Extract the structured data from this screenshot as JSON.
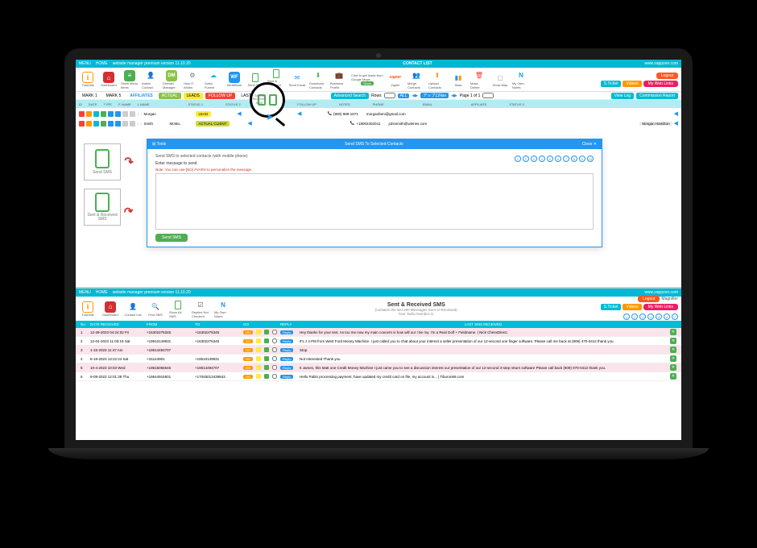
{
  "upper": {
    "header": {
      "menu": "MENU",
      "home": "HOME",
      "status_text": "website manager premium version 11.10.20",
      "title": "CONTACT LIST",
      "site": "www.zappzen.com"
    },
    "toolbar": {
      "items": [
        {
          "label": "Tutorials",
          "icon": "info"
        },
        {
          "label": "Dashboard",
          "icon": "home"
        },
        {
          "label": "Show Menu Items",
          "icon": "green"
        },
        {
          "label": "Admin Contact",
          "icon": "user"
        },
        {
          "label": "Domain Manager",
          "icon": "dm"
        },
        {
          "label": "How IT Works",
          "icon": "gear"
        },
        {
          "label": "Sales Funnel",
          "icon": "cloud"
        },
        {
          "label": "Workflows",
          "icon": "wf"
        },
        {
          "label": "Send SMS",
          "icon": "phone-green"
        },
        {
          "label": "Sent & Received SMS",
          "icon": "phone-green"
        },
        {
          "label": "Send Email",
          "icon": "mail"
        },
        {
          "label": "Download Contacts",
          "icon": "download"
        },
        {
          "label": "Business Profile",
          "icon": "briefcase"
        },
        {
          "label": "Google Maps",
          "icon": "gmaps",
          "extra": "Click to get leads from Google Maps"
        },
        {
          "label": "Zapier",
          "icon": "zapier"
        },
        {
          "label": "Merge Contacts",
          "icon": "merge"
        },
        {
          "label": "Upload Contacts",
          "icon": "upload"
        },
        {
          "label": "Stats",
          "icon": "bars"
        },
        {
          "label": "Mass Delete",
          "icon": "trash"
        },
        {
          "label": "Show Map",
          "icon": "map"
        },
        {
          "label": "My Own Notes",
          "icon": "n"
        }
      ],
      "right": {
        "logout": "Logout",
        "ticket": "S.Ticket",
        "videos": "Videos",
        "weblinks": "My Web Links"
      }
    },
    "tabs": {
      "mark1": "MARK 1",
      "mark5": "MARK 5",
      "affiliates": "AFFILIATES",
      "actual": "ACTUAL",
      "leads": "LEADS",
      "followup": "FOLLOW UP",
      "last20": "LAST 20",
      "sms": "SMS",
      "advanced_search": "Advanced Search",
      "rows": "Rows",
      "page_total": "Page 1 of 1",
      "btn_all": "ALL",
      "viewlog": "View Log",
      "commission": "Commission Report"
    },
    "filter_cols": [
      "ID",
      "DATE",
      "TYPE",
      "F. NAME",
      "L.NAME",
      "STATUS 1",
      "STATUS 2",
      "GROUP",
      "FOLLOW UP",
      "NOTES",
      "PHONE",
      "EMAIL",
      "AFFILIATE",
      "STATUS 3"
    ],
    "contacts": [
      {
        "fname": "Morgan",
        "lname": "",
        "status1": "LEAD",
        "phone": "(800) 989-1871",
        "email": "morganfami@gmail.com"
      },
      {
        "fname": "Smith",
        "lname": "",
        "status1": "ACTUAL CLIENT",
        "phone": "+18002402041",
        "email": "johnsmith@wtimes.com",
        "affiliate": "Morgan Hamilton"
      }
    ]
  },
  "modal": {
    "brand": "Tools",
    "title": "Send SMS To Selected Contacts",
    "close": "Close",
    "desc": "Send SMS to selected contacts (with mobile phone)",
    "label": "Enter message to send",
    "note": "Note: You can use [NO] #VARS to personalize the message",
    "pages": [
      "1",
      "2",
      "3",
      "4",
      "5",
      "6",
      "7",
      "8",
      "9",
      "10"
    ],
    "send": "Send SMS"
  },
  "callouts": {
    "send": "Send SMS",
    "sent_received": "Sent & Received SMS"
  },
  "magnifier": {
    "label": "Sent & Received SMS"
  },
  "lower": {
    "header": {
      "menu": "MENU",
      "home": "HOME",
      "status_text": "website manager premium version 11.10.20",
      "site": "www.zappzen.com",
      "right_label": "Magnifier"
    },
    "toolbar": {
      "items": [
        {
          "label": "Tutorials"
        },
        {
          "label": "Dashboard"
        },
        {
          "label": "Contact List"
        },
        {
          "label": "Find SMS"
        },
        {
          "label": "Show All SMS"
        },
        {
          "label": "Replies Not Checked"
        },
        {
          "label": "My Own Notes"
        }
      ],
      "title": "Sent & Received SMS",
      "subtitle": "(contains the last 200 Messages Sent or Received)",
      "twilio": "Your Twilio Number is:",
      "right": {
        "logout": "Logout",
        "ticket": "S.Ticket",
        "videos": "Videos",
        "weblinks": "My Web Links"
      },
      "pager": [
        "1",
        "2",
        "3",
        "4",
        "5",
        "6",
        "7"
      ]
    },
    "columns": {
      "n": "No.",
      "date": "DATE RECEIVED",
      "from": "FROM",
      "to": "TO",
      "go": "GO",
      "sq1": "",
      "sq2": "",
      "check": "",
      "reply": "REPLY",
      "msg": "LAST SMS RECEIVED",
      "del": ""
    },
    "rows": [
      {
        "n": "1",
        "date": "12-29-2023 04:24:02 Fri",
        "from": "+16302275345",
        "to": "+16302275345",
        "go": "GO",
        "reply": "Reply",
        "msg": "Hey thanks for your text. As too me now my main concern is how will our I be my. I'm a Real Golf + Fieldname. | Nick ChessDirect."
      },
      {
        "n": "2",
        "date": "12-04-2023 11:03:19 Sat",
        "from": "+19510149931",
        "to": "+16302275345",
        "go": "GO",
        "reply": "Reply",
        "msg": "It's J 4 PM from West Ford Money Machine. I just called you to chat about your interest a seller presentation of our 12-second one finger software. Please call me back at (909) 470-0412 thank you."
      },
      {
        "n": "3",
        "date": "1-15-2023 11:47 Am",
        "from": "+19014494707",
        "to": "",
        "go": "GO",
        "reply": "Reply",
        "msg": "Stop"
      },
      {
        "n": "4",
        "date": "8-18-2023 13:22:24 Sat",
        "from": "+15144901",
        "to": "+19510149931",
        "go": "GO",
        "reply": "Reply",
        "msg": "Not Interested Thank you"
      },
      {
        "n": "5",
        "date": "10-4-2023 10:03 Wed",
        "from": "+19515056546",
        "to": "+19014494707",
        "go": "GO",
        "reply": "Reply",
        "msg": "It James, this Matt one Credit Money Machine I just came you to see a discussion interest our presentation of our 12-second 3-step return software Please call back (909) 070-0412 thank you."
      },
      {
        "n": "6",
        "date": "9-09-2023 12:01:39 Thu",
        "from": "+19544915501",
        "to": "+17045013439843",
        "go": "GO",
        "reply": "Reply",
        "msg": "Hello Pablo processing payment, have updated my credit card on file, my account is... | Tiburon69.com"
      }
    ]
  }
}
